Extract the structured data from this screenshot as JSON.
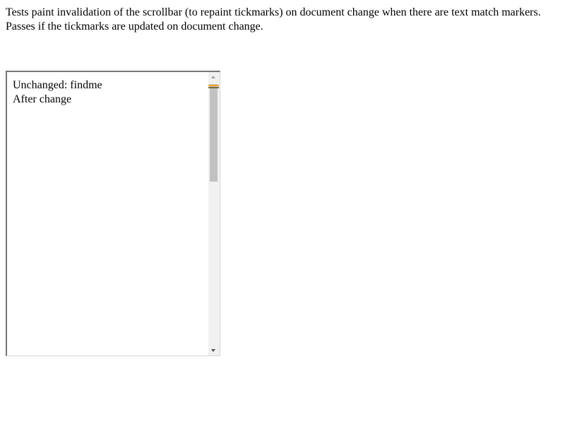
{
  "description": "Tests paint invalidation of the scrollbar (to repaint tickmarks) on document change when there are text match markers. Passes if the tickmarks are updated on document change.",
  "scroller": {
    "lines": [
      "Unchanged: findme",
      "After change"
    ]
  },
  "scrollbar": {
    "tickmark_colors": [
      "#f5a623",
      "#7a6a3a"
    ]
  },
  "icons": {
    "up": "arrow-up-icon",
    "down": "arrow-down-icon"
  }
}
